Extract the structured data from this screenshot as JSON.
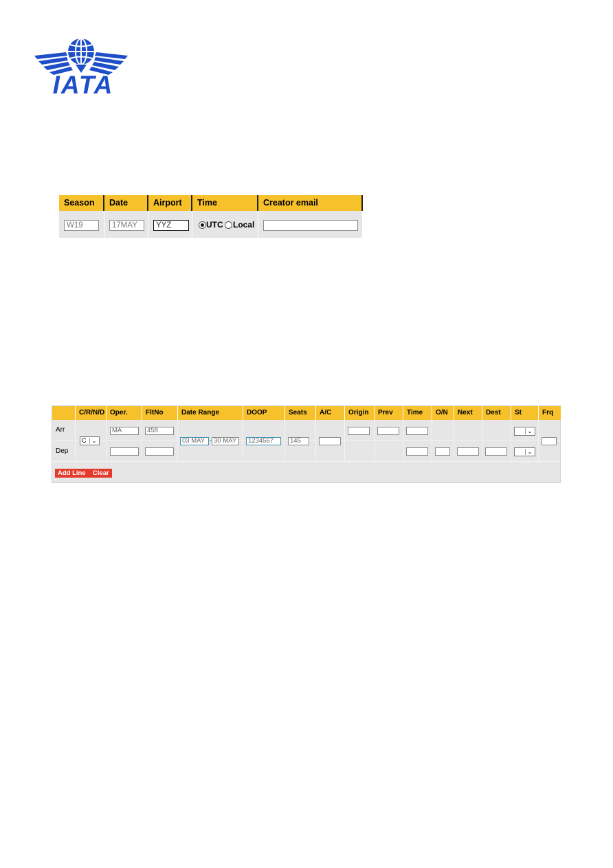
{
  "logo": {
    "text": "IATA",
    "brand_color": "#1e4fc8"
  },
  "form1": {
    "headers": {
      "season": "Season",
      "date": "Date",
      "airport": "Airport",
      "time": "Time",
      "email": "Creator email"
    },
    "values": {
      "season": "W19",
      "date": "17MAY",
      "airport": "YYZ",
      "email": ""
    },
    "time_options": [
      {
        "label": "UTC",
        "selected": true
      },
      {
        "label": "Local",
        "selected": false
      }
    ],
    "header_color": "#f7c12c"
  },
  "form2": {
    "headers": [
      "",
      "C/R/N/D",
      "Oper.",
      "FltNo",
      "Date Range",
      "DOOP",
      "Seats",
      "A/C",
      "Origin",
      "Prev",
      "Time",
      "O/N",
      "Next",
      "Dest",
      "St",
      "Frq"
    ],
    "rows": [
      {
        "label": "Arr",
        "oper": "MA",
        "fltno": "458",
        "origin": "",
        "prev": "",
        "time": "",
        "st": ""
      },
      {
        "label": "Dep",
        "oper": "",
        "fltno": "",
        "time": "",
        "on": "",
        "next": "",
        "dest": "",
        "st": ""
      }
    ],
    "shared": {
      "crnd": "C",
      "date_from": "03 MAY",
      "date_to": "30 MAY",
      "doop": "1234567",
      "seats": "145",
      "ac": "",
      "frq": ""
    },
    "buttons": {
      "add_line": "Add Line",
      "clear": "Clear"
    },
    "button_color": "#e43a2c"
  }
}
